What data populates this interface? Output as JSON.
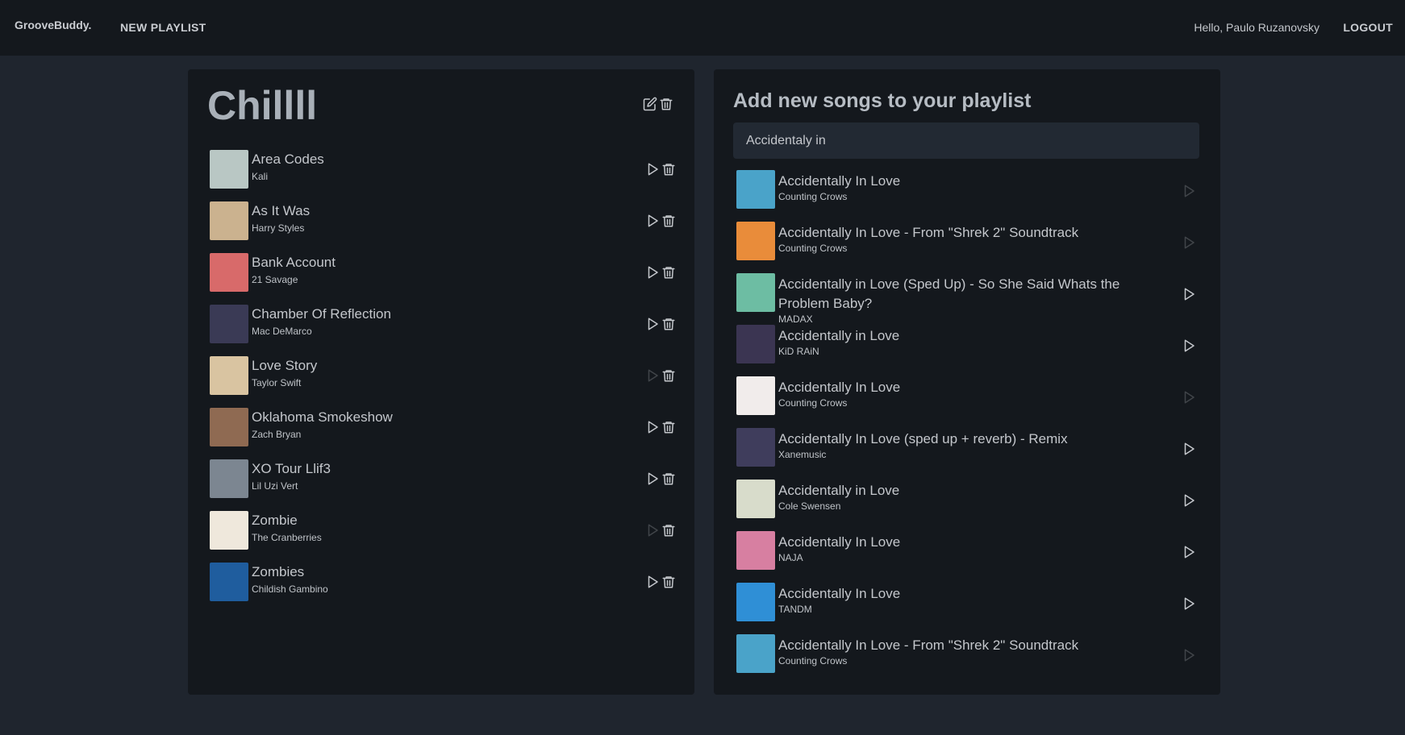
{
  "header": {
    "brand": "GrooveBuddy.",
    "new_playlist": "NEW PLAYLIST",
    "greeting": "Hello, Paulo Ruzanovsky",
    "logout": "LOGOUT"
  },
  "playlist": {
    "title": "Chillll",
    "icons": {
      "edit": "edit-icon",
      "delete": "trash-icon"
    },
    "songs": [
      {
        "title": "Area Codes",
        "artist": "Kali",
        "cover_color": "#b9c7c4",
        "playable": true
      },
      {
        "title": "As It Was",
        "artist": "Harry Styles",
        "cover_color": "#cbb28f",
        "playable": true
      },
      {
        "title": "Bank Account",
        "artist": "21 Savage",
        "cover_color": "#d86a6a",
        "playable": true
      },
      {
        "title": "Chamber Of Reflection",
        "artist": "Mac DeMarco",
        "cover_color": "#3a3a55",
        "playable": true
      },
      {
        "title": "Love Story",
        "artist": "Taylor Swift",
        "cover_color": "#d9c4a1",
        "playable": false
      },
      {
        "title": "Oklahoma Smokeshow",
        "artist": "Zach Bryan",
        "cover_color": "#8f6a52",
        "playable": true
      },
      {
        "title": "XO Tour Llif3",
        "artist": "Lil Uzi Vert",
        "cover_color": "#7c8691",
        "playable": true
      },
      {
        "title": "Zombie",
        "artist": "The Cranberries",
        "cover_color": "#efe8dc",
        "playable": false
      },
      {
        "title": "Zombies",
        "artist": "Childish Gambino",
        "cover_color": "#1f5d9e",
        "playable": true
      }
    ]
  },
  "search": {
    "title": "Add new songs to your playlist",
    "query": "Accidentaly in",
    "results": [
      {
        "title": "Accidentally In Love",
        "artist": "Counting Crows",
        "cover_color": "#4aa3c9",
        "playable": false
      },
      {
        "title": "Accidentally In Love - From \"Shrek 2\" Soundtrack",
        "artist": "Counting Crows",
        "cover_color": "#e98c3a",
        "playable": false
      },
      {
        "title": "Accidentally in Love (Sped Up) - So She Said Whats the Problem Baby?",
        "artist": "MADAX",
        "cover_color": "#6dbda3",
        "playable": true
      },
      {
        "title": "Accidentally in Love",
        "artist": "KiD RAiN",
        "cover_color": "#3b3552",
        "playable": true
      },
      {
        "title": "Accidentally In Love",
        "artist": "Counting Crows",
        "cover_color": "#f1eceb",
        "playable": false
      },
      {
        "title": "Accidentally In Love (sped up + reverb) - Remix",
        "artist": "Xanemusic",
        "cover_color": "#3f3d5c",
        "playable": true
      },
      {
        "title": "Accidentally in Love",
        "artist": "Cole Swensen",
        "cover_color": "#d8dccb",
        "playable": true
      },
      {
        "title": "Accidentally In Love",
        "artist": "NAJA",
        "cover_color": "#d77fa1",
        "playable": true
      },
      {
        "title": "Accidentally In Love",
        "artist": "TANDM",
        "cover_color": "#2f8fd6",
        "playable": true
      },
      {
        "title": "Accidentally In Love - From \"Shrek 2\" Soundtrack",
        "artist": "Counting Crows",
        "cover_color": "#4aa3c9",
        "playable": false
      }
    ]
  }
}
